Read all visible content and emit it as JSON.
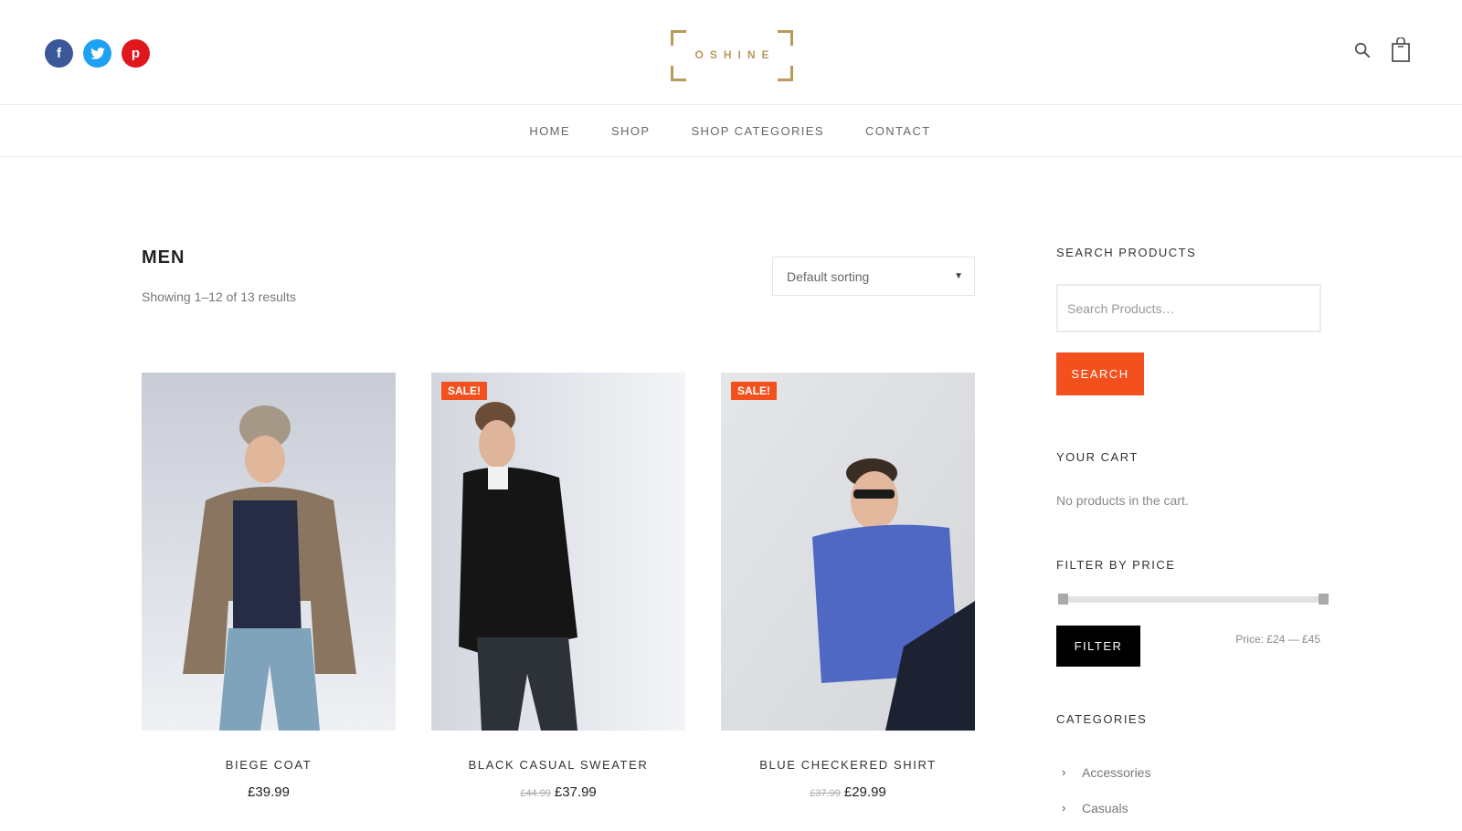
{
  "brand": {
    "logo_text": "OSHINE",
    "accent": "#b89a5a"
  },
  "header": {
    "socials": [
      {
        "name": "facebook",
        "glyph": "f",
        "color": "#3b5998"
      },
      {
        "name": "twitter",
        "glyph": "t",
        "color": "#1da1f2"
      },
      {
        "name": "pinterest",
        "glyph": "p",
        "color": "#e1171e"
      }
    ]
  },
  "nav": {
    "items": [
      "HOME",
      "SHOP",
      "SHOP CATEGORIES",
      "CONTACT"
    ]
  },
  "main": {
    "title": "MEN",
    "result_count": "Showing 1–12 of 13 results",
    "sort_label": "Default sorting",
    "sale_label": "SALE!",
    "products": [
      {
        "name": "BIEGE COAT",
        "price": "£39.99",
        "old_price": ""
      },
      {
        "name": "BLACK CASUAL SWEATER",
        "price": "£37.99",
        "old_price": "£44.99"
      },
      {
        "name": "BLUE CHECKERED SHIRT",
        "price": "£29.99",
        "old_price": "£37.99"
      }
    ]
  },
  "sidebar": {
    "search_title": "SEARCH PRODUCTS",
    "search_placeholder": "Search Products…",
    "search_button": "SEARCH",
    "cart_title": "YOUR CART",
    "cart_empty": "No products in the cart.",
    "filter_title": "FILTER BY PRICE",
    "filter_button": "FILTER",
    "price_range": "Price: £24 — £45",
    "categories_title": "CATEGORIES",
    "categories": [
      "Accessories",
      "Casuals"
    ]
  },
  "colors": {
    "sale": "#f4501e",
    "search_button": "#f4501e",
    "filter_button": "#000000"
  }
}
